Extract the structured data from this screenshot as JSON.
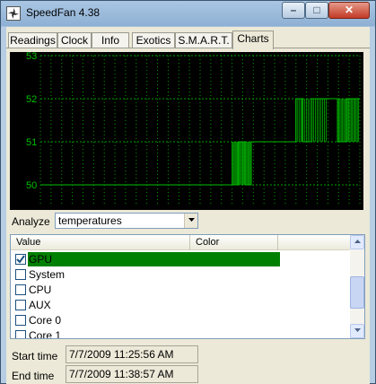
{
  "window": {
    "title": "SpeedFan 4.38"
  },
  "window_controls": {
    "minimize": "–",
    "maximize": "□",
    "close": "✕"
  },
  "tabs": [
    {
      "label": "Readings",
      "active": false
    },
    {
      "label": "Clock",
      "active": false
    },
    {
      "label": "Info",
      "active": false
    },
    {
      "label": "Exotics",
      "active": false
    },
    {
      "label": "S.M.A.R.T.",
      "active": false
    },
    {
      "label": "Charts",
      "active": true
    }
  ],
  "chart_data": {
    "type": "line",
    "title": "",
    "xlabel": "",
    "ylabel": "",
    "ylim": [
      49.5,
      53
    ],
    "yticks": [
      "53",
      "52",
      "51",
      "50"
    ],
    "background": "#000000",
    "line_color": "#00c000",
    "grid_color": "#00a000",
    "grid": true,
    "x": [
      "11:25:56",
      "11:38:57"
    ],
    "series": [
      {
        "name": "",
        "x": [
          0,
          0.6,
          0.62,
          0.64,
          0.66,
          0.68,
          0.75,
          0.8,
          0.82,
          0.85,
          0.9,
          0.93,
          0.96,
          1.0
        ],
        "values": [
          50,
          50,
          51,
          50,
          51,
          51,
          51,
          52,
          51,
          52,
          52,
          51,
          52,
          52
        ]
      }
    ]
  },
  "analyze": {
    "label": "Analyze",
    "value": "temperatures"
  },
  "list": {
    "columns": [
      "Value",
      "Color"
    ],
    "rows": [
      {
        "label": "GPU",
        "checked": true,
        "color": "#008000"
      },
      {
        "label": "System",
        "checked": false
      },
      {
        "label": "CPU",
        "checked": false
      },
      {
        "label": "AUX",
        "checked": false
      },
      {
        "label": "Core 0",
        "checked": false
      },
      {
        "label": "Core 1",
        "checked": false
      }
    ]
  },
  "times": {
    "start_label": "Start time",
    "start_value": "7/7/2009 11:25:56 AM",
    "end_label": "End time",
    "end_value": "7/7/2009 11:38:57 AM"
  }
}
